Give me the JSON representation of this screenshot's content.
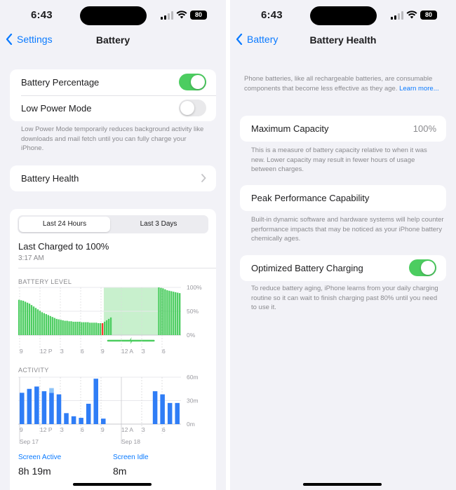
{
  "status": {
    "time": "6:43",
    "battery": "80"
  },
  "left": {
    "nav": {
      "back": "Settings",
      "title": "Battery"
    },
    "settings": {
      "battery_percentage": "Battery Percentage",
      "low_power": "Low Power Mode",
      "battery_percentage_on": true,
      "low_power_on": false
    },
    "low_power_note": "Low Power Mode temporarily reduces background activity like downloads and mail fetch until you can fully charge your iPhone.",
    "battery_health": "Battery Health",
    "tabs": [
      "Last 24 Hours",
      "Last 3 Days"
    ],
    "last_charged": "Last Charged to 100%",
    "last_charged_time": "3:17 AM",
    "battery_level_label": "BATTERY LEVEL",
    "activity_label": "ACTIVITY",
    "screen_active_label": "Screen Active",
    "screen_active_value": "8h 19m",
    "screen_idle_label": "Screen Idle",
    "screen_idle_value": "8m"
  },
  "chart_data": [
    {
      "type": "bar",
      "title": "BATTERY LEVEL",
      "y_ticks": [
        "100%",
        "50%",
        "0%"
      ],
      "ylim": [
        0,
        100
      ],
      "x_ticks": [
        "9",
        "12 P",
        "3",
        "6",
        "9",
        "12 A",
        "3",
        "6"
      ],
      "values": [
        74,
        73,
        72,
        70,
        68,
        66,
        63,
        60,
        57,
        54,
        51,
        48,
        46,
        44,
        42,
        40,
        38,
        36,
        34,
        33,
        32,
        31,
        30,
        30,
        29,
        29,
        28,
        28,
        28,
        28,
        27,
        27,
        27,
        27,
        26,
        26,
        26,
        26,
        25,
        25,
        25,
        28,
        31,
        34,
        37,
        null,
        null,
        null,
        null,
        null,
        null,
        null,
        null,
        null,
        null,
        null,
        null,
        null,
        null,
        null,
        null,
        null,
        null,
        null,
        null,
        null,
        null,
        100,
        99,
        98,
        96,
        94,
        93,
        92,
        91,
        90,
        89,
        88
      ],
      "charging_shaded": true,
      "colors": {
        "bar": "#4ccd60",
        "low": "#ff3b30",
        "shade": "#c8f0cd"
      }
    },
    {
      "type": "bar",
      "title": "ACTIVITY",
      "y_ticks": [
        "60m",
        "30m",
        "0m"
      ],
      "ylim": [
        0,
        60
      ],
      "x_ticks": [
        "9",
        "12 P",
        "3",
        "6",
        "9",
        "12 A",
        "3",
        "6"
      ],
      "date_labels": [
        "Sep 17",
        "Sep 18"
      ],
      "units": "minutes",
      "values": [
        40,
        45,
        48,
        42,
        40,
        38,
        14,
        10,
        8,
        26,
        58,
        7,
        0,
        0,
        0,
        0,
        0,
        0,
        42,
        38,
        27,
        27
      ],
      "idle_values": [
        0,
        0,
        0,
        0,
        6,
        0,
        0,
        0,
        0,
        0,
        0,
        0,
        0,
        0,
        0,
        0,
        0,
        0,
        0,
        0,
        0,
        0
      ],
      "colors": {
        "active": "#2f7df6",
        "idle": "#8ec4f8"
      }
    }
  ],
  "right": {
    "nav": {
      "back": "Battery",
      "title": "Battery Health"
    },
    "intro": "Phone batteries, like all rechargeable batteries, are consumable components that become less effective as they age.",
    "learn_more": "Learn more...",
    "max_capacity_label": "Maximum Capacity",
    "max_capacity_value": "100%",
    "max_capacity_note": "This is a measure of battery capacity relative to when it was new. Lower capacity may result in fewer hours of usage between charges.",
    "peak_label": "Peak Performance Capability",
    "peak_note": "Built-in dynamic software and hardware systems will help counter performance impacts that may be noticed as your iPhone battery chemically ages.",
    "optimized_label": "Optimized Battery Charging",
    "optimized_on": true,
    "optimized_note": "To reduce battery aging, iPhone learns from your daily charging routine so it can wait to finish charging past 80% until you need to use it."
  }
}
